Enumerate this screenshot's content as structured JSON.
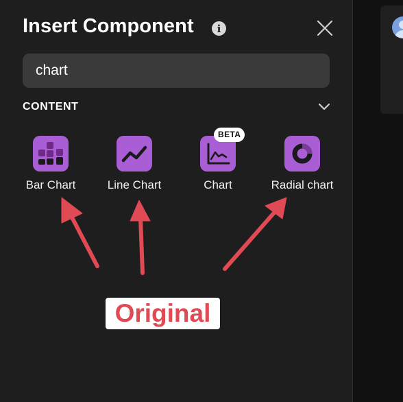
{
  "dialog": {
    "title": "Insert Component",
    "info_icon": "info-icon",
    "close_icon": "close-icon"
  },
  "search": {
    "value": "chart",
    "icon": "none"
  },
  "section": {
    "label": "CONTENT",
    "toggle_icon": "chevron-down-icon"
  },
  "components": [
    {
      "label": "Bar Chart",
      "icon": "bar-chart-icon"
    },
    {
      "label": "Line Chart",
      "icon": "line-chart-icon"
    },
    {
      "label": "Chart",
      "icon": "chart-icon",
      "badge": "BETA"
    },
    {
      "label": "Radial chart",
      "icon": "radial-chart-icon"
    }
  ],
  "annotation": {
    "label": "Original",
    "color": "#e04a55"
  },
  "colors": {
    "panel_bg": "#1e1e1e",
    "tile_purple": "#a95ed6",
    "input_bg": "#3a3a3a",
    "arrow_red": "#e04a55"
  }
}
